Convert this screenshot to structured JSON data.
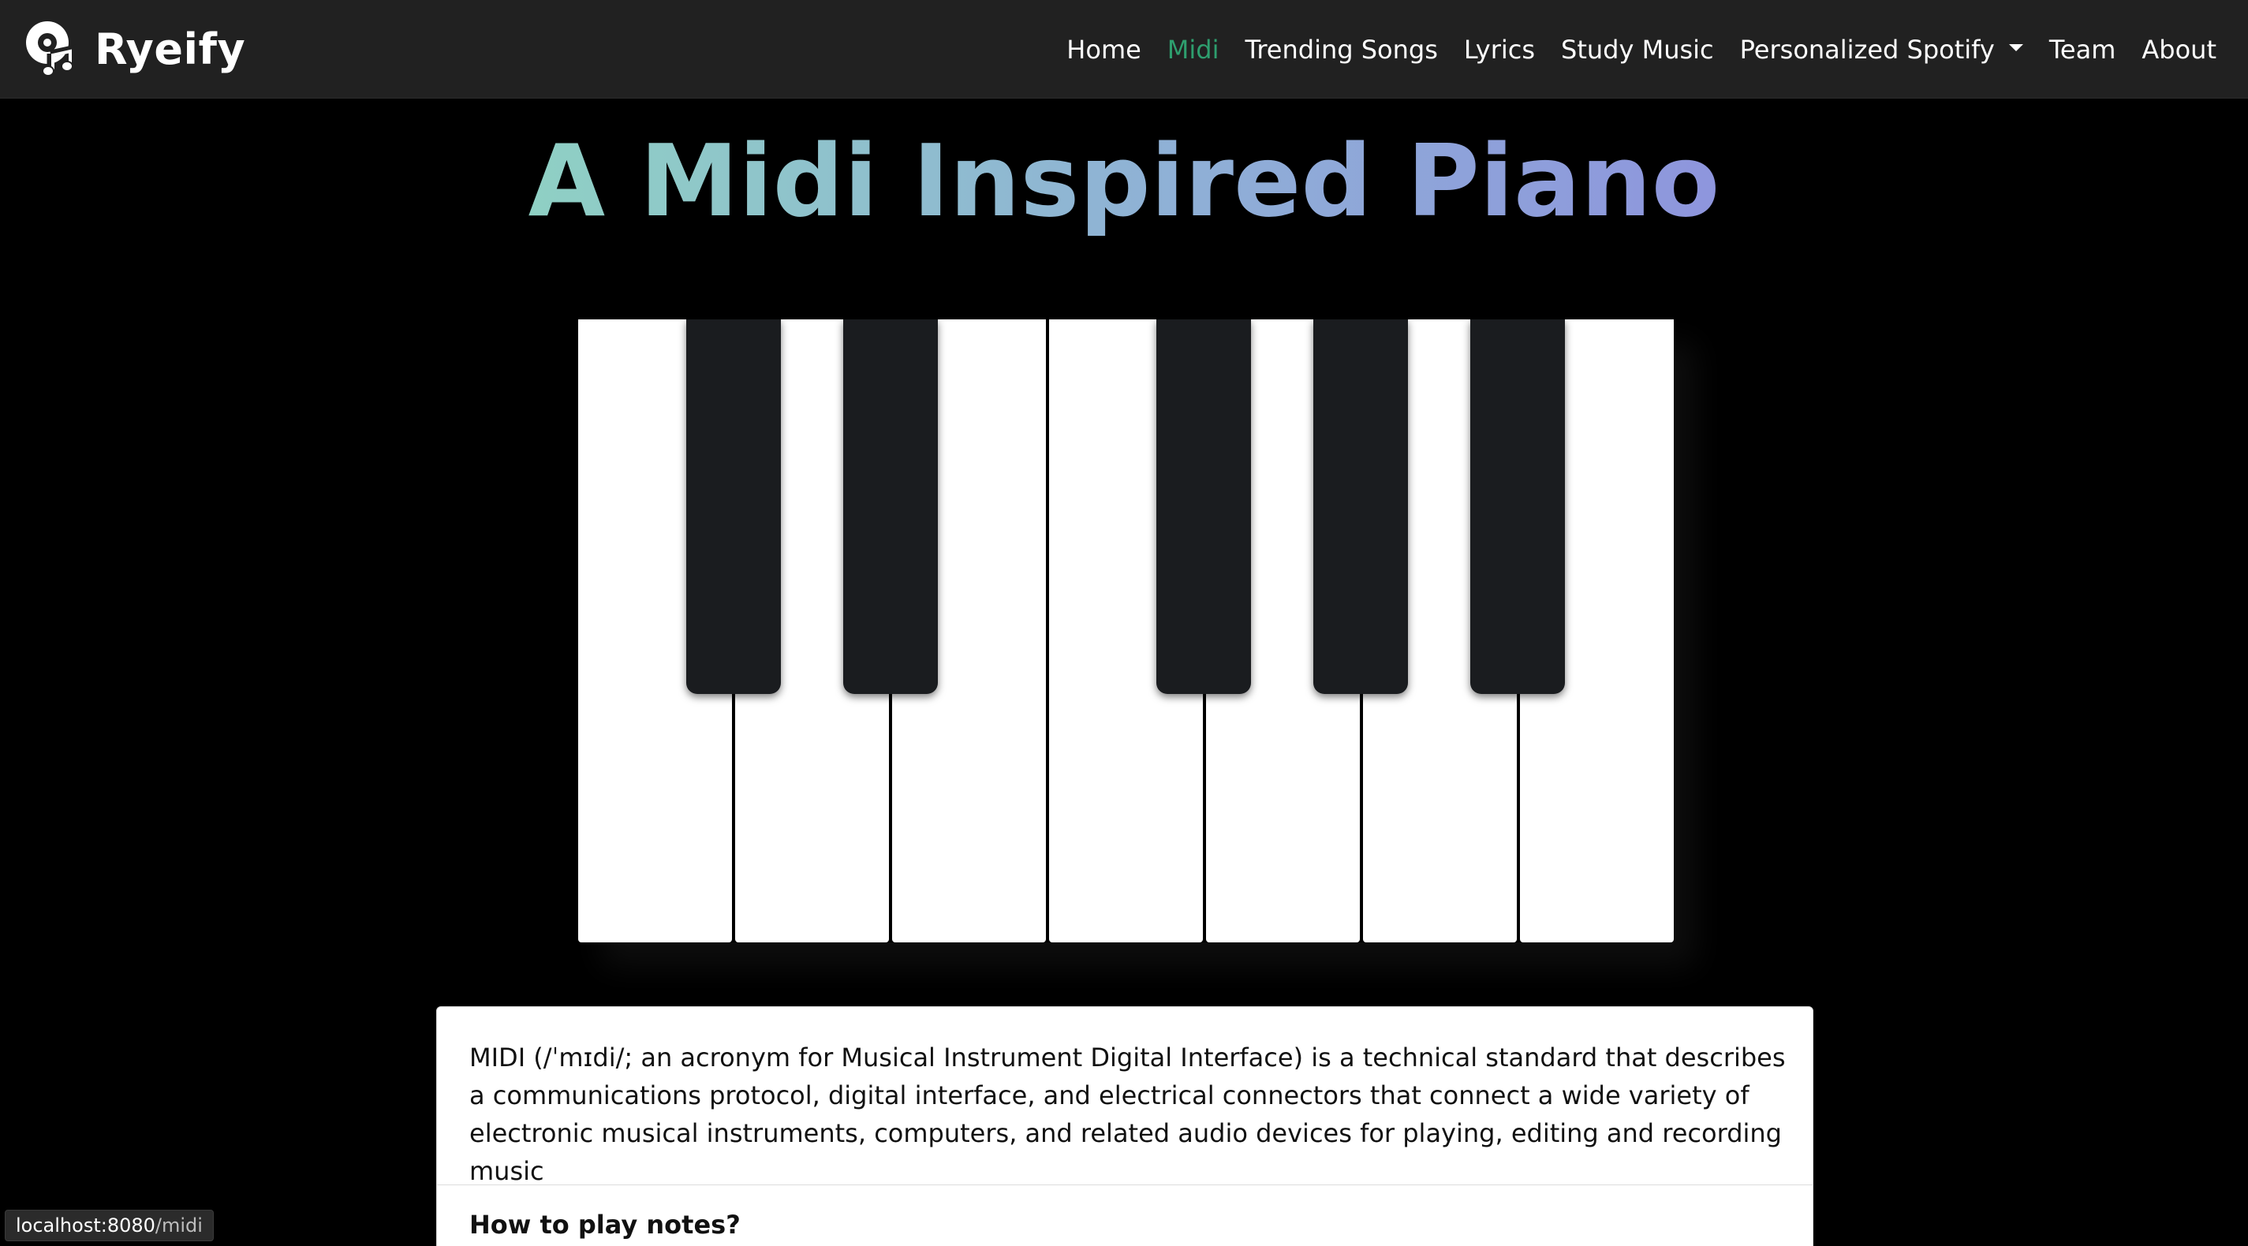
{
  "brand": {
    "name": "Ryeify",
    "icon": "vinyl-note-logo-icon"
  },
  "nav": {
    "items": [
      {
        "label": "Home",
        "active": false
      },
      {
        "label": "Midi",
        "active": true
      },
      {
        "label": "Trending Songs",
        "active": false
      },
      {
        "label": "Lyrics",
        "active": false
      },
      {
        "label": "Study Music",
        "active": false
      },
      {
        "label": "Personalized Spotify",
        "active": false,
        "dropdown": true
      },
      {
        "label": "Team",
        "active": false
      },
      {
        "label": "About",
        "active": false
      }
    ],
    "active_color": "#2e9e6e"
  },
  "hero": {
    "title": "A Midi Inspired Piano",
    "gradient_colors": [
      "#8fd0c4",
      "#8fb0d6",
      "#8e95dd"
    ]
  },
  "piano": {
    "white_key_count": 7,
    "black_key_count": 5,
    "white_color": "#ffffff",
    "black_color": "#1a1c1f"
  },
  "info": {
    "description": "MIDI (/ˈmɪdi/; an acronym for Musical Instrument Digital Interface) is a technical standard that describes a communications protocol, digital interface, and electrical connectors that connect a wide variety of electronic musical instruments, computers, and related audio devices for playing, editing and recording music",
    "how_to_heading": "How to play notes?"
  },
  "status_bar": {
    "host": "localhost:8080",
    "path": "/midi"
  }
}
